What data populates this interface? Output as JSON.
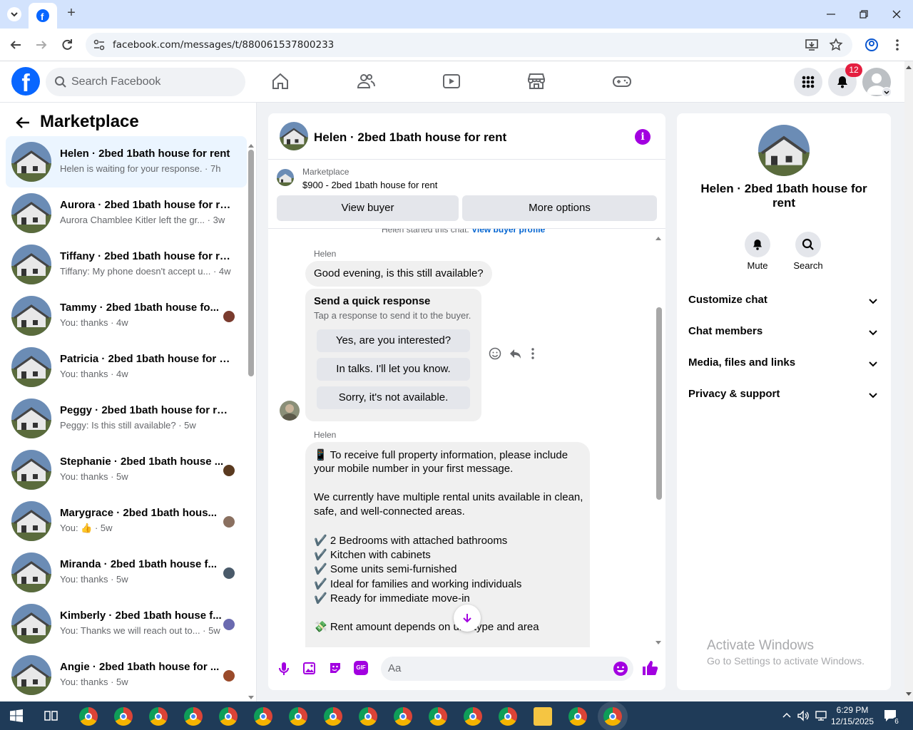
{
  "browser": {
    "url": "facebook.com/messages/t/880061537800233"
  },
  "header": {
    "search_placeholder": "Search Facebook",
    "notification_count": "12"
  },
  "left_panel": {
    "title": "Marketplace",
    "conversations": [
      {
        "name": "Helen · 2bed 1bath house for rent",
        "preview": "Helen is waiting for your response. · 7h",
        "active": true
      },
      {
        "name": "Aurora · 2bed 1bath house for re...",
        "preview": "Aurora Chamblee Kitler left the gr...  · 3w"
      },
      {
        "name": "Tiffany · 2bed 1bath house for re...",
        "preview": "Tiffany: My phone doesn't accept u... · 4w"
      },
      {
        "name": "Tammy · 2bed 1bath house fo...",
        "preview": "You: thanks · 4w"
      },
      {
        "name": "Patricia · 2bed 1bath house for r...",
        "preview": "You: thanks · 4w"
      },
      {
        "name": "Peggy · 2bed 1bath house for rent",
        "preview": "Peggy: Is this still available? · 5w"
      },
      {
        "name": "Stephanie · 2bed 1bath house ...",
        "preview": "You: thanks · 5w"
      },
      {
        "name": "Marygrace · 2bed 1bath hous...",
        "preview": "You: 👍 · 5w"
      },
      {
        "name": "Miranda · 2bed 1bath house f...",
        "preview": "You: thanks · 5w"
      },
      {
        "name": "Kimberly · 2bed 1bath house f...",
        "preview": "You: Thanks we will reach out to... · 5w"
      },
      {
        "name": "Angie · 2bed 1bath house for ...",
        "preview": "You: thanks · 5w"
      }
    ]
  },
  "chat": {
    "title": "Helen · 2bed 1bath house for rent",
    "marketplace_label": "Marketplace",
    "listing": "$900 - 2bed 1bath house for rent",
    "view_buyer": "View buyer",
    "more_options": "More options",
    "started_note": "Helen started this chat.",
    "view_buyer_profile": "View buyer profile",
    "sender1": "Helen",
    "msg1": "Good evening, is this still available?",
    "quick_title": "Send a quick response",
    "quick_sub": "Tap a response to send it to the buyer.",
    "quick_responses": [
      "Yes, are you interested?",
      "In talks. I'll let you know.",
      "Sorry, it's not available."
    ],
    "sender2": "Helen",
    "msg2_lines": [
      "📱 To receive full property information, please include",
      "your mobile number in your first message.",
      "",
      "We currently have multiple rental units available in clean,",
      "safe, and well-connected areas.",
      "",
      "✔️ 2 Bedrooms with attached bathrooms",
      "✔️ Kitchen with cabinets",
      "✔️ Some units semi-furnished",
      "✔️ Ideal for families and working individuals",
      "✔️ Ready for immediate move-in",
      "",
      "💸 Rent amount depends on unit type and area"
    ],
    "input_placeholder": "Aa"
  },
  "right_panel": {
    "name": "Helen · 2bed 1bath house for rent",
    "mute": "Mute",
    "search": "Search",
    "sections": [
      "Customize chat",
      "Chat members",
      "Media, files and links",
      "Privacy & support"
    ]
  },
  "watermark": {
    "title": "Activate Windows",
    "subtitle": "Go to Settings to activate Windows."
  },
  "taskbar": {
    "time": "6:29 PM",
    "date": "12/15/2025",
    "notif_count": "6"
  },
  "colors": {
    "fb_blue": "#0866ff",
    "accent_purple": "#a200e0",
    "badge_red": "#e41e3f"
  }
}
